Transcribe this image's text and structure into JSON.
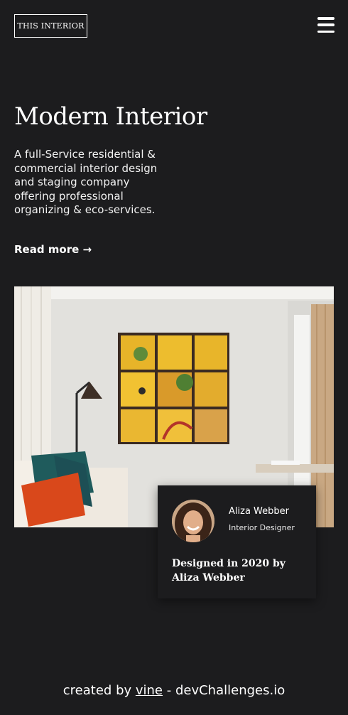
{
  "header": {
    "logo_text": "THIS INTERIOR",
    "menu_icon": "hamburger-menu-icon"
  },
  "hero": {
    "title": "Modern Interior",
    "description": "A full-Service residential & commercial interior design and staging company offering professional organizing & eco-services.",
    "read_more_label": "Read more",
    "read_more_icon": "→"
  },
  "card": {
    "name": "Aliza Webber",
    "role": "Interior Designer",
    "caption": "Designed in 2020 by Aliza Webber"
  },
  "footer": {
    "prefix": "created by ",
    "link_text": "vine",
    "suffix": " - devChallenges.io"
  },
  "colors": {
    "background": "#1c1c1e",
    "text": "#ffffff"
  }
}
